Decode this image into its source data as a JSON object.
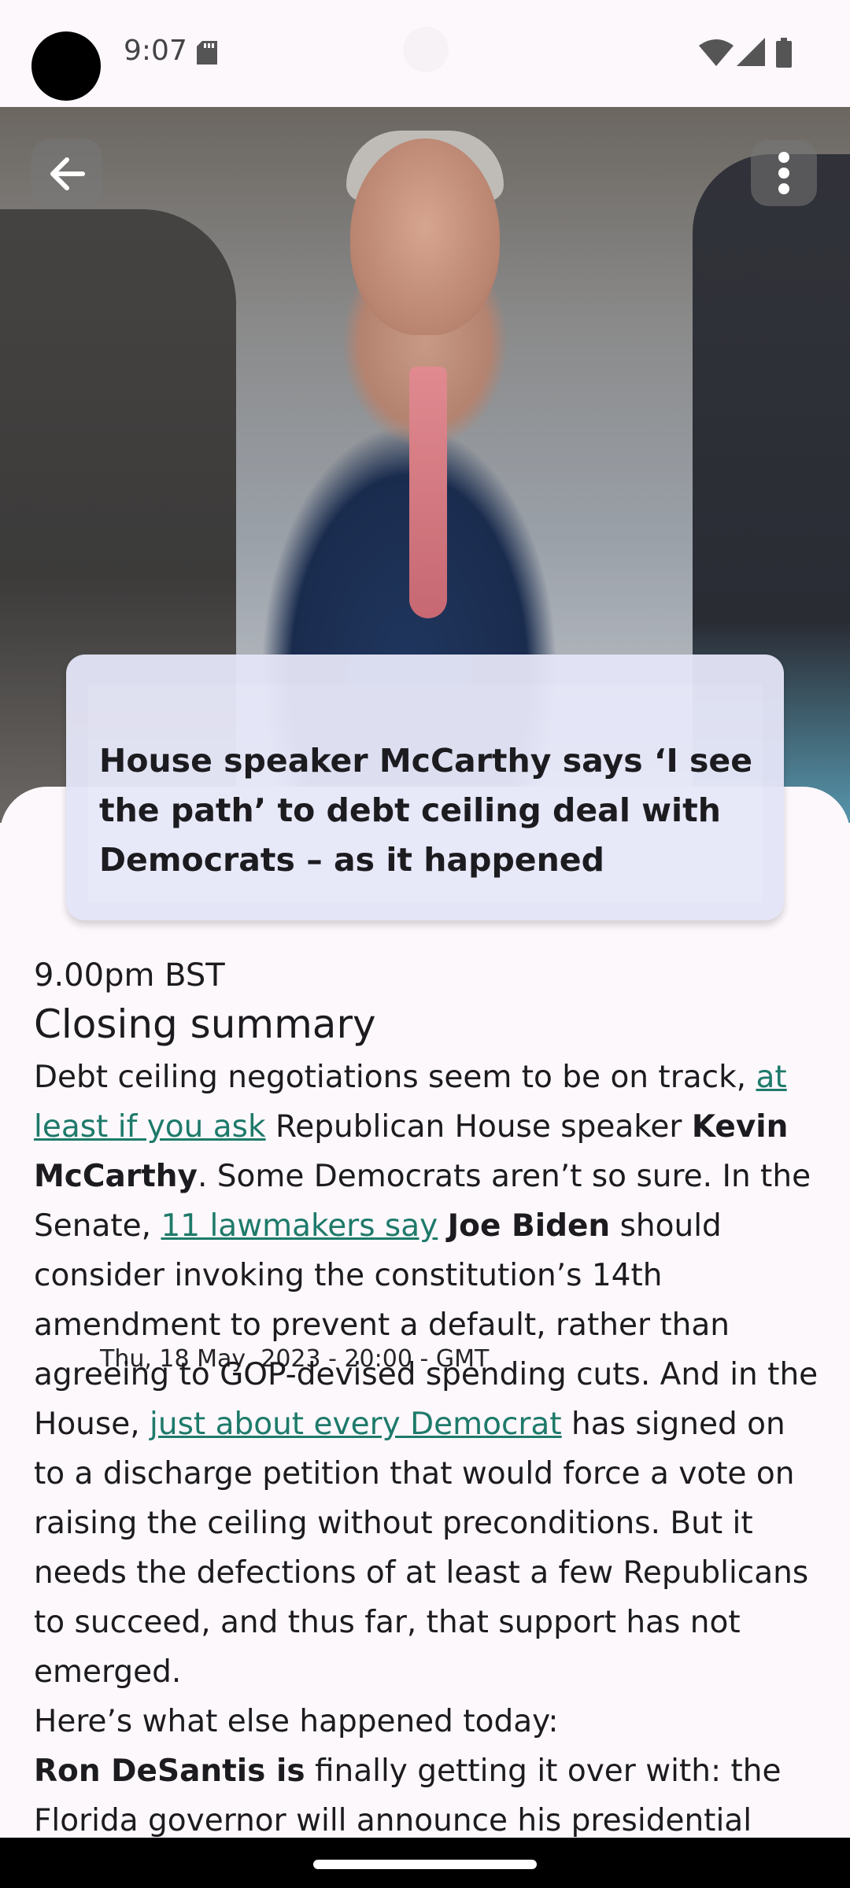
{
  "status_bar": {
    "time": "9:07"
  },
  "article": {
    "date_line": "Thu, 18 May, 2023 - 20:00 - GMT",
    "title": "House speaker McCarthy says ‘I see the path’ to debt ceiling deal with Democrats – as it happened",
    "timestamp": "9.00pm BST",
    "section_heading": "Closing summary",
    "paragraph1": {
      "t1": "Debt ceiling negotiations seem to be on track, ",
      "link1": "at least if you ask",
      "t2": " Republican House speaker ",
      "b1": "Kevin McCarthy",
      "t3": ". Some Democrats aren’t so sure. In the Senate, ",
      "link2": "11 lawmakers say",
      "t4": " ",
      "b2": "Joe Biden",
      "t5": " should consider invoking the constitution’s 14th amendment to prevent a default, rather than agreeing to GOP-devised spending cuts. And in the House, ",
      "link3": "just about every Democrat",
      "t6": " has signed on to a discharge petition that would force a vote on raising the ceiling without preconditions. But it needs the defections of at least a few Republicans to succeed, and thus far, that support has not emerged."
    },
    "paragraph2": "Here’s what else happened today:",
    "paragraph3": {
      "b1": "Ron DeSantis is",
      "t1": " finally getting it over with: the Florida governor will announce his presidential"
    }
  },
  "colors": {
    "link": "#1e7a6a",
    "background": "#fdf8fc",
    "card": "#e3e4f6"
  },
  "icons": {
    "back": "arrow-left-icon",
    "more": "more-vert-icon"
  }
}
